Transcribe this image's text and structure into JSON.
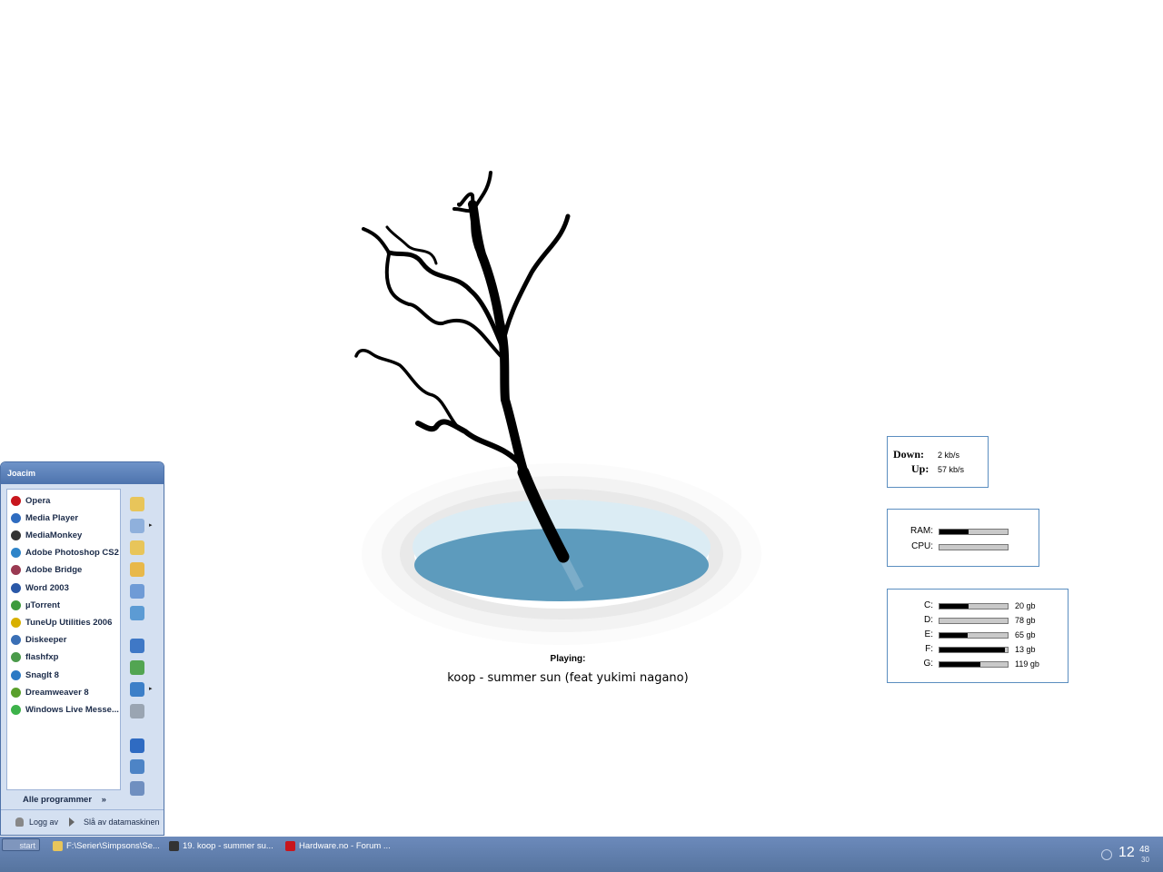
{
  "now_playing": {
    "label": "Playing:",
    "track": "koop - summer sun (feat yukimi nagano)"
  },
  "network": {
    "down_label": "Down:",
    "down_value": "2 kb/s",
    "up_label": "Up:",
    "up_value": "57 kb/s"
  },
  "system": {
    "ram_label": "RAM:",
    "ram_fraction": 0.43,
    "cpu_label": "CPU:",
    "cpu_fraction": 0.0
  },
  "drives": [
    {
      "label": "C:",
      "fraction": 0.42,
      "value": "20 gb"
    },
    {
      "label": "D:",
      "fraction": 0.0,
      "value": "78 gb"
    },
    {
      "label": "E:",
      "fraction": 0.41,
      "value": "65 gb"
    },
    {
      "label": "F:",
      "fraction": 0.96,
      "value": "13 gb"
    },
    {
      "label": "G:",
      "fraction": 0.6,
      "value": "119 gb"
    }
  ],
  "start_menu": {
    "user": "Joacim",
    "programs": [
      {
        "label": "Opera",
        "icon": "opera-icon",
        "color": "#c8161d"
      },
      {
        "label": "Media Player",
        "icon": "media-player-icon",
        "color": "#2f6cc0"
      },
      {
        "label": "MediaMonkey",
        "icon": "mediamonkey-icon",
        "color": "#333333"
      },
      {
        "label": "Adobe Photoshop CS2",
        "icon": "photoshop-icon",
        "color": "#2e84c9"
      },
      {
        "label": "Adobe Bridge",
        "icon": "bridge-icon",
        "color": "#9a3a52"
      },
      {
        "label": "Word 2003",
        "icon": "word-icon",
        "color": "#2a58a8"
      },
      {
        "label": "µTorrent",
        "icon": "utorrent-icon",
        "color": "#3c9a3c"
      },
      {
        "label": "TuneUp Utilities 2006",
        "icon": "tuneup-icon",
        "color": "#d8b000"
      },
      {
        "label": "Diskeeper",
        "icon": "diskeeper-icon",
        "color": "#3a6fb5"
      },
      {
        "label": "flashfxp",
        "icon": "flashfxp-icon",
        "color": "#4a9a4a"
      },
      {
        "label": "SnagIt 8",
        "icon": "snagit-icon",
        "color": "#2c7ac4"
      },
      {
        "label": "Dreamweaver 8",
        "icon": "dreamweaver-icon",
        "color": "#5aa02c"
      },
      {
        "label": "Windows Live Messe...",
        "icon": "messenger-icon",
        "color": "#3db24a"
      }
    ],
    "all_programs": "Alle programmer",
    "all_programs_arrow": "»",
    "logoff": "Logg av",
    "shutdown": "Slå av datamaskinen",
    "right_icons": [
      {
        "icon": "my-documents-icon",
        "color": "#e8c55a",
        "arrow": ""
      },
      {
        "icon": "recent-documents-icon",
        "color": "#8fb0dc",
        "arrow": "▸"
      },
      {
        "icon": "my-pictures-icon",
        "color": "#e8c55a",
        "arrow": ""
      },
      {
        "icon": "my-music-icon",
        "color": "#e8b84a",
        "arrow": ""
      },
      {
        "icon": "my-computer-icon",
        "color": "#6f9bd6",
        "arrow": ""
      },
      {
        "icon": "network-places-icon",
        "color": "#5c9bd4",
        "arrow": ""
      },
      {
        "icon": "control-panel-icon",
        "color": "#3f78c6",
        "arrow": ""
      },
      {
        "icon": "default-programs-icon",
        "color": "#52a552",
        "arrow": ""
      },
      {
        "icon": "connect-to-icon",
        "color": "#3c7fc8",
        "arrow": "▸"
      },
      {
        "icon": "printers-icon",
        "color": "#9aa5b2",
        "arrow": ""
      },
      {
        "icon": "help-icon",
        "color": "#2f6bc2",
        "arrow": ""
      },
      {
        "icon": "search-icon",
        "color": "#4d84c6",
        "arrow": ""
      },
      {
        "icon": "run-icon",
        "color": "#6f8fc0",
        "arrow": ""
      }
    ]
  },
  "taskbar": {
    "start_label": "start",
    "items": [
      {
        "label": "F:\\Serier\\Simpsons\\Se...",
        "icon": "folder-icon",
        "color": "#e8c55a"
      },
      {
        "label": "19. koop - summer su...",
        "icon": "mediamonkey-icon",
        "color": "#333333"
      },
      {
        "label": "Hardware.no - Forum ...",
        "icon": "opera-icon",
        "color": "#c8161d"
      }
    ],
    "clock_hour": "12",
    "clock_minute": "48",
    "clock_second": "30"
  }
}
